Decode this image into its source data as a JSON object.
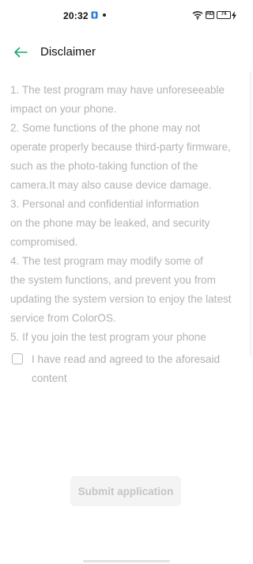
{
  "status_bar": {
    "time": "20:32",
    "sim_label": "HD",
    "battery_level": "74",
    "icons": [
      "app-notification-icon",
      "dot-icon",
      "wifi-icon",
      "sim-icon",
      "battery-icon",
      "charging-icon"
    ]
  },
  "header": {
    "title": "Disclaimer",
    "back_icon": "arrow-left-icon",
    "accent_color": "#1fa56e"
  },
  "disclaimer": {
    "lines": [
      "1. The test program may have unforeseeable",
      "impact on your phone.",
      "2. Some functions of the phone may not",
      "operate properly because third-party firmware,",
      "such as the photo-taking function of the",
      "camera.It may also cause device damage.",
      "3. Personal and confidential information",
      "on the phone may be leaked, and security",
      "compromised.",
      "4. The test program may modify some of",
      "the system functions, and prevent you from",
      "updating the system version to enjoy the latest",
      "service from ColorOS.",
      "5. If you join the test program your phone"
    ]
  },
  "agreement": {
    "checked": false,
    "label": "I have read and agreed to the aforesaid content"
  },
  "submit": {
    "label": "Submit application",
    "enabled": false
  }
}
